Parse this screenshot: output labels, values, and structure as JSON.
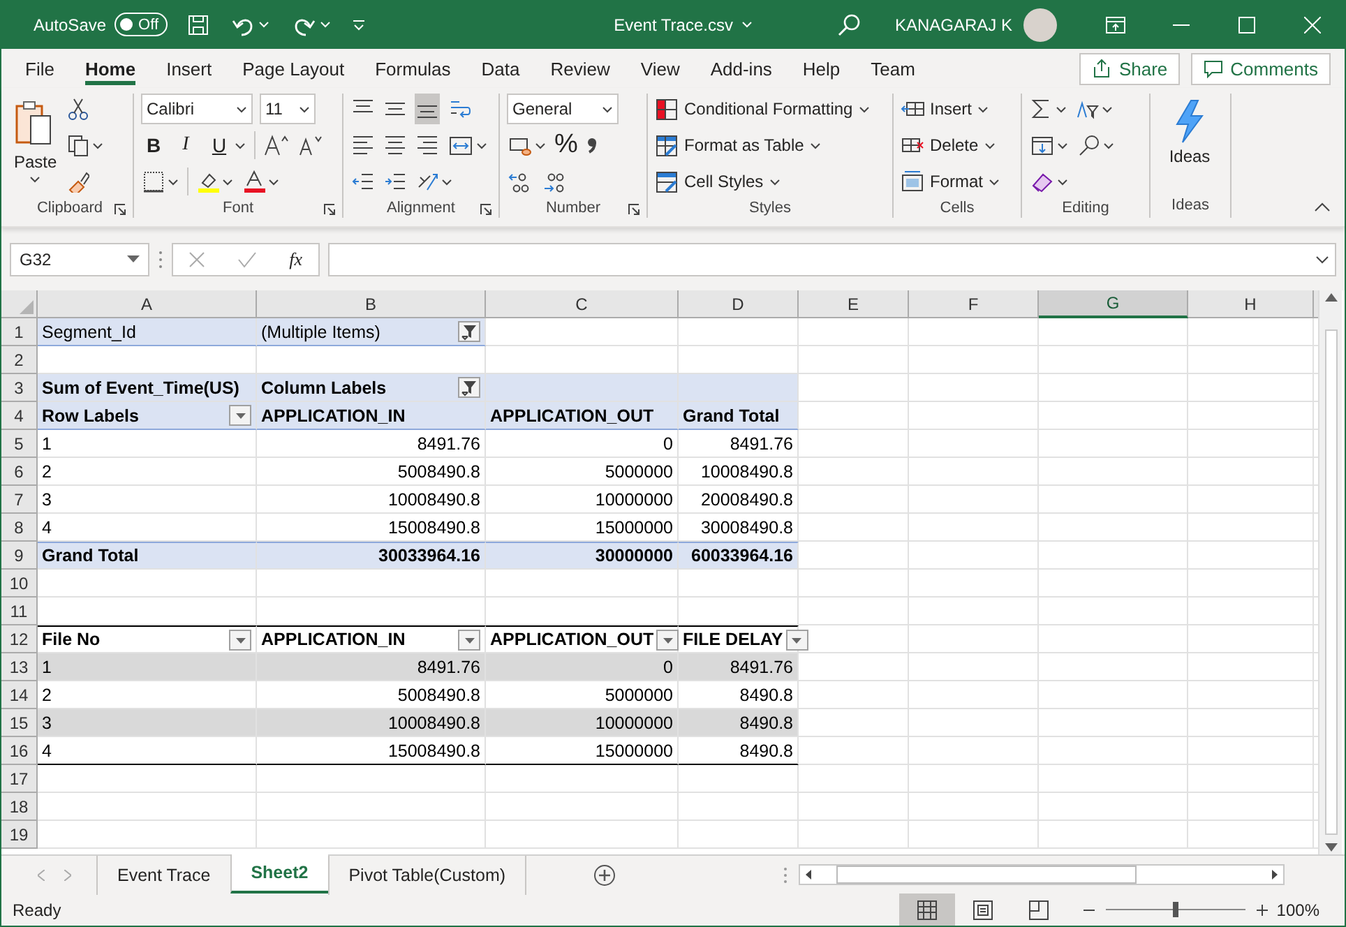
{
  "title_bar": {
    "autosave": {
      "label": "AutoSave",
      "on": false,
      "state_text": "Off"
    },
    "title": "Event Trace.csv",
    "user": "KANAGARAJ K"
  },
  "menu_tabs": [
    {
      "label": "File",
      "selected": false
    },
    {
      "label": "Home",
      "selected": true
    },
    {
      "label": "Insert",
      "selected": false
    },
    {
      "label": "Page Layout",
      "selected": false
    },
    {
      "label": "Formulas",
      "selected": false
    },
    {
      "label": "Data",
      "selected": false
    },
    {
      "label": "Review",
      "selected": false
    },
    {
      "label": "View",
      "selected": false
    },
    {
      "label": "Add-ins",
      "selected": false
    },
    {
      "label": "Help",
      "selected": false
    },
    {
      "label": "Team",
      "selected": false
    }
  ],
  "share_button": "Share",
  "comments_button": "Comments",
  "ribbon": {
    "clipboard": {
      "label": "Clipboard",
      "paste": "Paste"
    },
    "font": {
      "label": "Font",
      "font_name": "Calibri",
      "font_size": "11",
      "bold": "B",
      "italic": "I",
      "underline": "U"
    },
    "alignment": {
      "label": "Alignment"
    },
    "number": {
      "label": "Number",
      "format": "General",
      "percent": "%"
    },
    "styles": {
      "label": "Styles",
      "buttons": [
        "Conditional Formatting",
        "Format as Table",
        "Cell Styles"
      ]
    },
    "cells": {
      "label": "Cells",
      "buttons": [
        "Insert",
        "Delete",
        "Format"
      ]
    },
    "editing": {
      "label": "Editing"
    },
    "ideas": {
      "label": "Ideas",
      "button": "Ideas"
    }
  },
  "formula_bar": {
    "name_box": "G32",
    "function_label": "fx"
  },
  "sheet": {
    "columns": [
      {
        "label": "A",
        "selected": false
      },
      {
        "label": "B",
        "selected": false
      },
      {
        "label": "C",
        "selected": false
      },
      {
        "label": "D",
        "selected": false
      },
      {
        "label": "E",
        "selected": false
      },
      {
        "label": "F",
        "selected": false
      },
      {
        "label": "G",
        "selected": true
      },
      {
        "label": "H",
        "selected": false
      }
    ],
    "rows": [
      {
        "label": "1",
        "kind": "pivot-filter",
        "cells": [
          {
            "text": "Segment_Id",
            "shaded": true
          },
          {
            "text": "(Multiple Items)",
            "shaded": true,
            "filter_button": true
          }
        ]
      },
      {
        "label": "2",
        "kind": "plain",
        "cells": []
      },
      {
        "label": "3",
        "kind": "plain",
        "cells": [
          {
            "text": "Sum of Event_Time(US)",
            "shaded": true,
            "bold": true
          },
          {
            "text": "Column Labels",
            "shaded": true,
            "bold": true,
            "filter_button": true
          },
          {
            "shaded": true
          },
          {
            "shaded": true
          }
        ]
      },
      {
        "label": "4",
        "kind": "pivot-header",
        "cells": [
          {
            "text": "Row Labels",
            "shaded": true,
            "bold": true,
            "dropdown_button": true
          },
          {
            "text": "APPLICATION_IN",
            "shaded": true,
            "bold": true
          },
          {
            "text": "APPLICATION_OUT",
            "shaded": true,
            "bold": true
          },
          {
            "text": "Grand Total",
            "shaded": true,
            "bold": true
          }
        ]
      },
      {
        "label": "5",
        "kind": "plain",
        "cells": [
          {
            "text": "1"
          },
          {
            "text": "8491.76",
            "align_right": true
          },
          {
            "text": "0",
            "align_right": true
          },
          {
            "text": "8491.76",
            "align_right": true
          }
        ]
      },
      {
        "label": "6",
        "kind": "plain",
        "cells": [
          {
            "text": "2"
          },
          {
            "text": "5008490.8",
            "align_right": true
          },
          {
            "text": "5000000",
            "align_right": true
          },
          {
            "text": "10008490.8",
            "align_right": true
          }
        ]
      },
      {
        "label": "7",
        "kind": "plain",
        "cells": [
          {
            "text": "3"
          },
          {
            "text": "10008490.8",
            "align_right": true
          },
          {
            "text": "10000000",
            "align_right": true
          },
          {
            "text": "20008490.8",
            "align_right": true
          }
        ]
      },
      {
        "label": "8",
        "kind": "plain",
        "cells": [
          {
            "text": "4"
          },
          {
            "text": "15008490.8",
            "align_right": true
          },
          {
            "text": "15000000",
            "align_right": true
          },
          {
            "text": "30008490.8",
            "align_right": true
          }
        ]
      },
      {
        "label": "9",
        "kind": "pivot-total",
        "cells": [
          {
            "text": "Grand Total",
            "shaded": true,
            "bold": true
          },
          {
            "text": "30033964.16",
            "shaded": true,
            "bold": true,
            "align_right": true
          },
          {
            "text": "30000000",
            "shaded": true,
            "bold": true,
            "align_right": true
          },
          {
            "text": "60033964.16",
            "shaded": true,
            "bold": true,
            "align_right": true
          }
        ]
      },
      {
        "label": "10",
        "kind": "plain",
        "cells": []
      },
      {
        "label": "11",
        "kind": "plain",
        "cells": []
      },
      {
        "label": "12",
        "kind": "table-header",
        "cells": [
          {
            "text": "File No",
            "bold": true,
            "dropdown_button": true
          },
          {
            "text": "APPLICATION_IN",
            "bold": true,
            "dropdown_button": true
          },
          {
            "text": "APPLICATION_OUT",
            "bold": true,
            "dropdown_button": true
          },
          {
            "text": "FILE DELAY",
            "bold": true,
            "dropdown_button": true
          }
        ]
      },
      {
        "label": "13",
        "kind": "plain",
        "cells": [
          {
            "text": "1",
            "banded": true
          },
          {
            "text": "8491.76",
            "banded": true,
            "align_right": true
          },
          {
            "text": "0",
            "banded": true,
            "align_right": true
          },
          {
            "text": "8491.76",
            "banded": true,
            "align_right": true
          }
        ]
      },
      {
        "label": "14",
        "kind": "plain",
        "cells": [
          {
            "text": "2"
          },
          {
            "text": "5008490.8",
            "align_right": true
          },
          {
            "text": "5000000",
            "align_right": true
          },
          {
            "text": "8490.8",
            "align_right": true
          }
        ]
      },
      {
        "label": "15",
        "kind": "plain",
        "cells": [
          {
            "text": "3",
            "banded": true
          },
          {
            "text": "10008490.8",
            "banded": true,
            "align_right": true
          },
          {
            "text": "10000000",
            "banded": true,
            "align_right": true
          },
          {
            "text": "8490.8",
            "banded": true,
            "align_right": true
          }
        ]
      },
      {
        "label": "16",
        "kind": "table-end",
        "cells": [
          {
            "text": "4"
          },
          {
            "text": "15008490.8",
            "align_right": true
          },
          {
            "text": "15000000",
            "align_right": true
          },
          {
            "text": "8490.8",
            "align_right": true
          }
        ]
      },
      {
        "label": "17",
        "kind": "plain",
        "cells": []
      },
      {
        "label": "18",
        "kind": "plain",
        "cells": []
      },
      {
        "label": "19",
        "kind": "plain",
        "cells": []
      }
    ]
  },
  "sheet_tabs": [
    {
      "label": "Event Trace",
      "selected": false
    },
    {
      "label": "Sheet2",
      "selected": true
    },
    {
      "label": "Pivot Table(Custom)",
      "selected": false
    }
  ],
  "status_bar": {
    "status": "Ready",
    "views": [
      {
        "selected": true
      },
      {
        "selected": false
      },
      {
        "selected": false
      }
    ],
    "zoom": {
      "level": 0.5,
      "reading": "100%"
    }
  }
}
